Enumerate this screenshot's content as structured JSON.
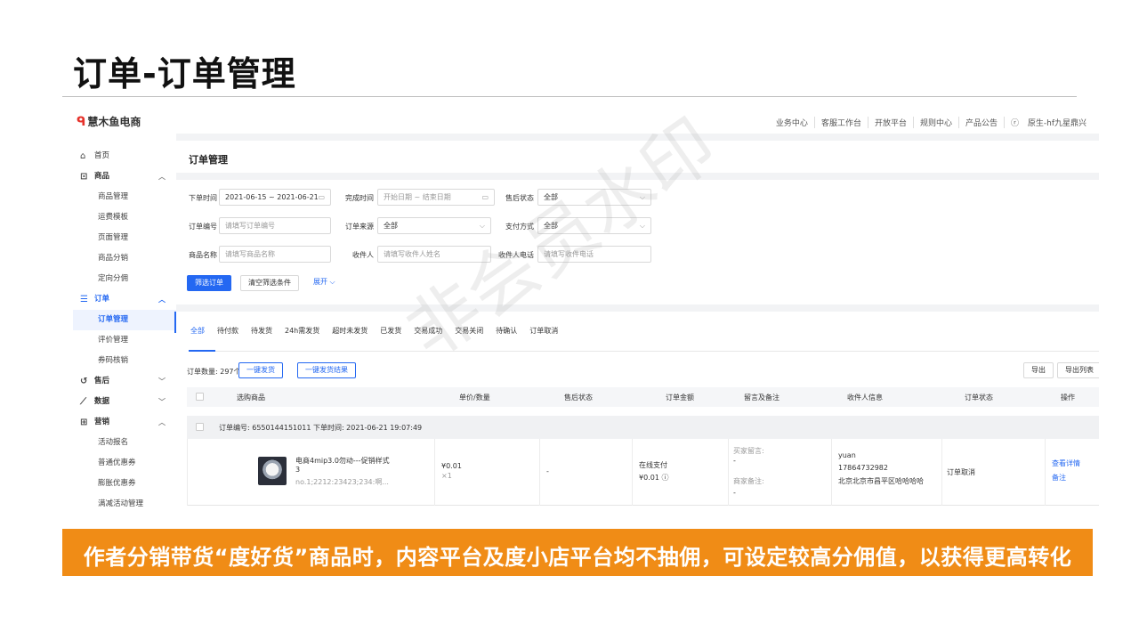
{
  "slide": {
    "title": "订单-订单管理",
    "banner": "作者分销带货“度好货”商品时，内容平台及度小店平台均不抽佣，可设定较高分佣值，以获得更高转化",
    "watermark": "非会员水印"
  },
  "app": {
    "logo": "慧木鱼电商",
    "topnav": [
      "业务中心",
      "客服工作台",
      "开放平台",
      "规则中心",
      "产品公告",
      "原生-hf九星鼎兴"
    ],
    "sidebar": {
      "home": "首页",
      "goods": "商品",
      "goods_items": [
        "商品管理",
        "运费模板",
        "页面管理",
        "商品分销",
        "定向分佣"
      ],
      "orders": "订单",
      "order_items": [
        "订单管理",
        "评价管理",
        "券码核销"
      ],
      "aftersale": "售后",
      "data": "数据",
      "marketing": "营销",
      "marketing_items": [
        "活动报名",
        "普通优惠券",
        "膨胀优惠券",
        "满减活动管理"
      ]
    },
    "page_title": "订单管理",
    "filters": {
      "order_time_label": "下单时间",
      "order_time_value": "2021-06-15 ~ 2021-06-21",
      "finish_time_label": "完成时间",
      "finish_time_start": "开始日期",
      "finish_time_sep": "~",
      "finish_time_end": "结束日期",
      "aftersale_label": "售后状态",
      "aftersale_value": "全部",
      "order_no_label": "订单编号",
      "order_no_placeholder": "请填写订单编号",
      "source_label": "订单来源",
      "source_value": "全部",
      "pay_label": "支付方式",
      "pay_value": "全部",
      "goods_name_label": "商品名称",
      "goods_name_placeholder": "请填写商品名称",
      "receiver_label": "收件人",
      "receiver_placeholder": "请填写收件人姓名",
      "phone_label": "收件人电话",
      "phone_placeholder": "请填写收件电话",
      "btn_filter": "筛选订单",
      "btn_clear": "清空筛选条件",
      "btn_expand": "展开"
    },
    "tabs": [
      "全部",
      "待付款",
      "待发货",
      "24h需发货",
      "超时未发货",
      "已发货",
      "交易成功",
      "交易关闭",
      "待确认",
      "订单取消"
    ],
    "count_label": "订单数量: 297个",
    "btn_ship": "一键发货",
    "btn_ship_result": "一键发货结果",
    "btn_export": "导出",
    "btn_export_list": "导出列表",
    "columns": [
      "选购商品",
      "单价/数量",
      "售后状态",
      "订单金额",
      "留言及备注",
      "收件人信息",
      "订单状态",
      "操作"
    ],
    "order": {
      "header": "订单编号: 6550144151011   下单时间: 2021-06-21 19:07:49",
      "product_name": "电商4mip3.0勿动---促销样式3",
      "product_sku": "no.1;2212:23423;234:啊...",
      "price": "¥0.01",
      "qty": "×1",
      "aftersale": "-",
      "pay_type": "在线支付",
      "amount": "¥0.01 ⓘ",
      "buyer_msg_label": "买家留言:",
      "buyer_msg": "-",
      "seller_note_label": "商家备注:",
      "seller_note": "-",
      "receiver_name": "yuan",
      "receiver_phone": "17864732982",
      "receiver_addr": "北京北京市昌平区哈哈哈哈",
      "status": "订单取消",
      "action_detail": "查看详情",
      "action_note": "备注"
    }
  }
}
